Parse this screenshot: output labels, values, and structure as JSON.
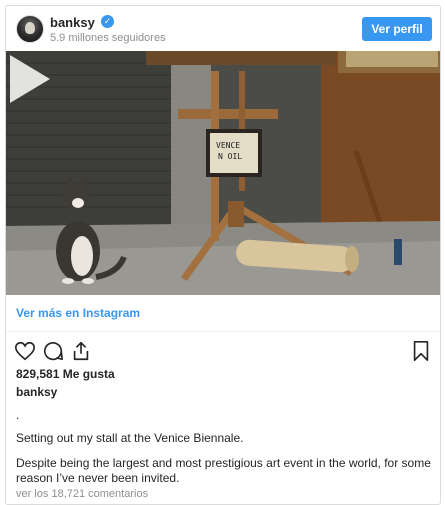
{
  "header": {
    "username": "banksy",
    "verified_icon": "verified-badge-icon",
    "followers": "5.9 millones seguidores",
    "follow_label": "Ver perfil"
  },
  "media": {
    "sign_text_line1": "VENCE",
    "sign_text_line2": "N OIL",
    "play_icon": "play-icon"
  },
  "more_link": "Ver más en Instagram",
  "actions": {
    "like_icon": "heart-icon",
    "comment_icon": "comment-icon",
    "share_icon": "share-icon",
    "save_icon": "bookmark-icon"
  },
  "likes": "829,581 Me gusta",
  "author": "banksy",
  "caption": {
    "dot": ".",
    "line1": "Setting out my stall at the Venice Biennale.",
    "line2": "Despite being the largest and most prestigious art event in the world, for some reason I’ve never been invited."
  },
  "comments_link": "ver los 18,721 comentarios",
  "colors": {
    "accent": "#3897f0",
    "muted": "#8e8e8e",
    "border": "#dbdbdb"
  }
}
